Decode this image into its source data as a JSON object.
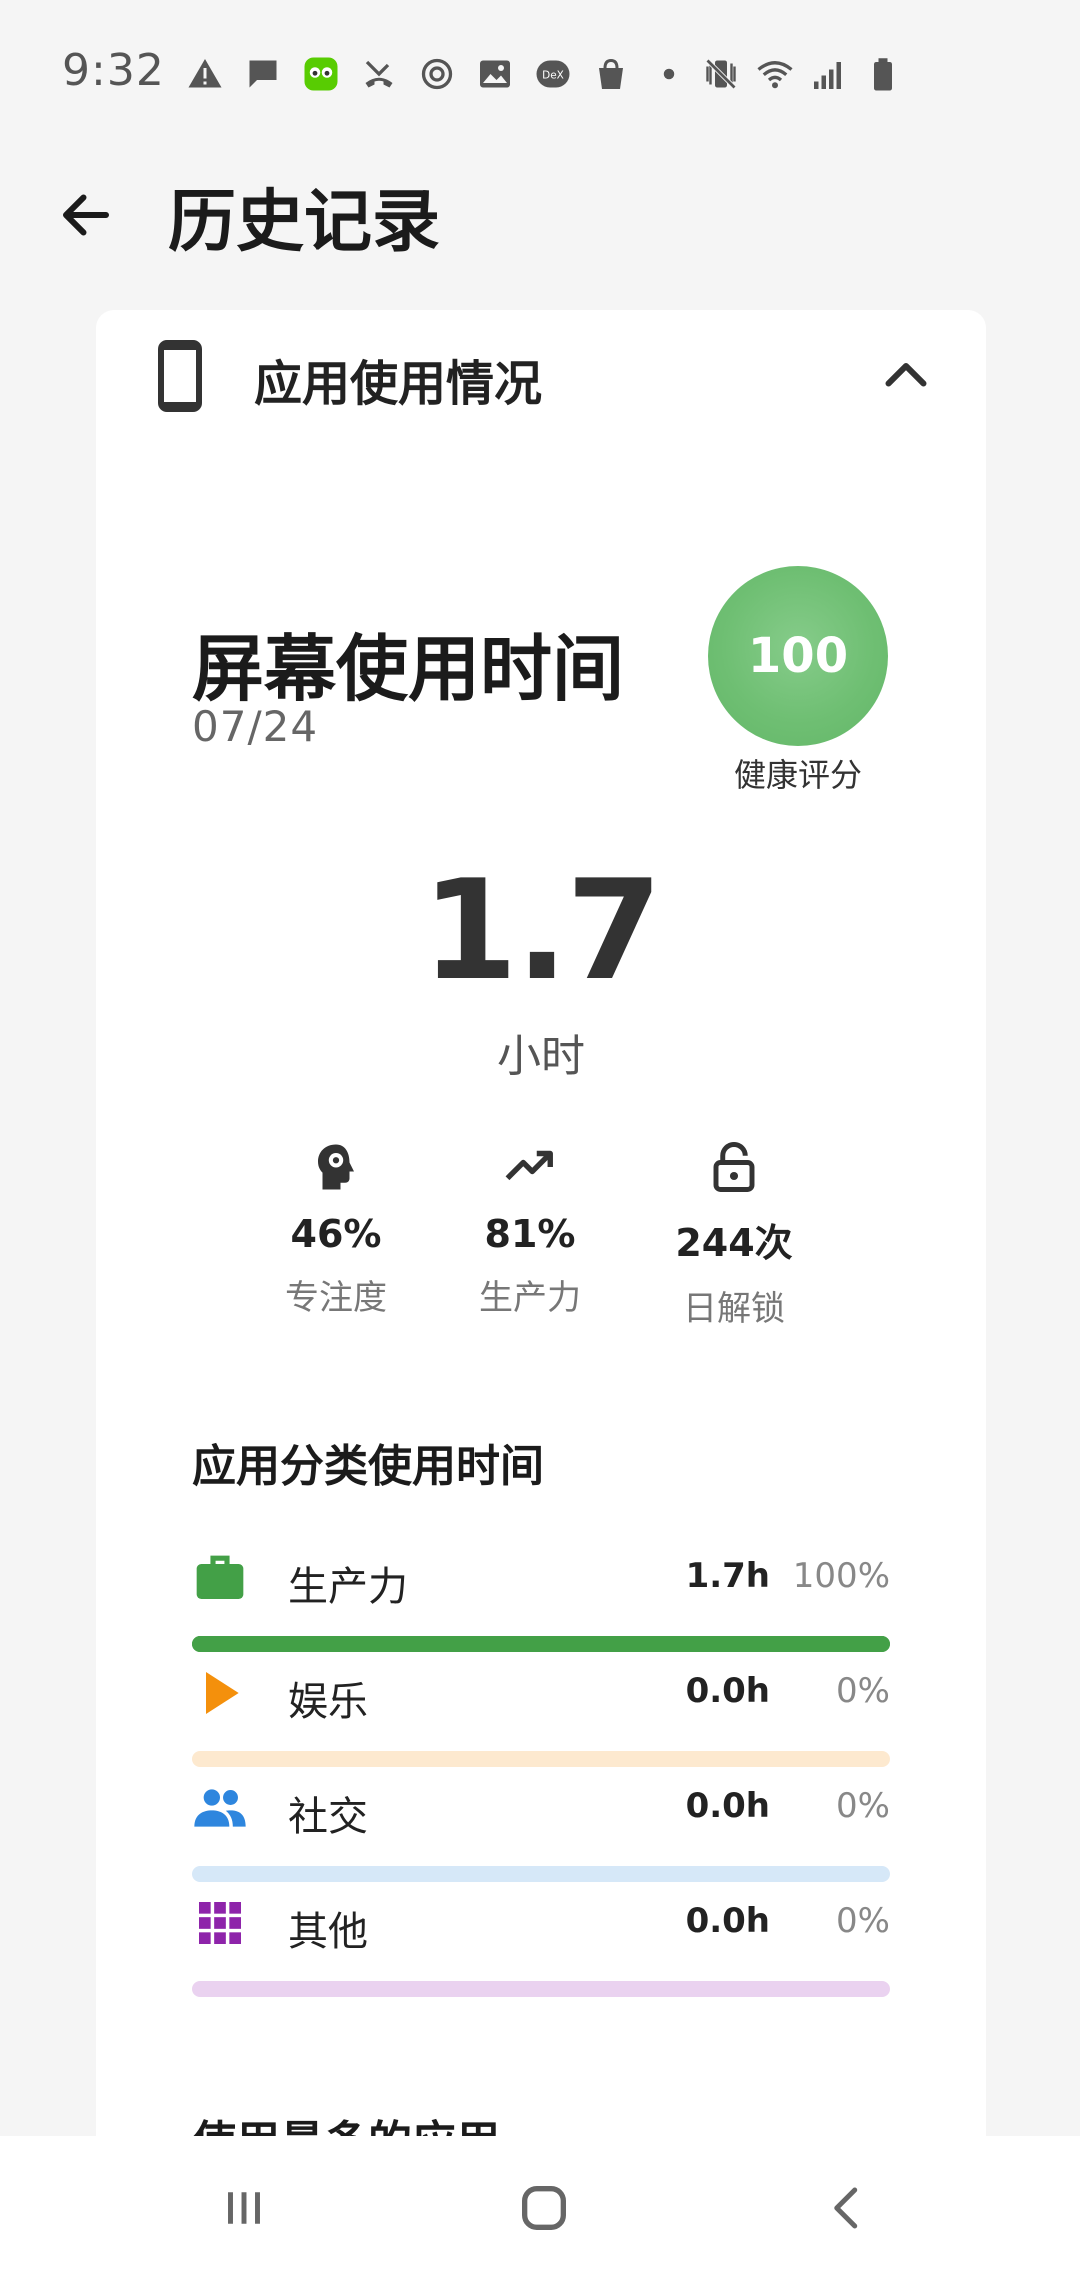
{
  "status_bar": {
    "time": "9:32",
    "icons": [
      "warning-icon",
      "message-icon",
      "duolingo-icon",
      "missed-call-icon",
      "sync-icon",
      "gallery-icon",
      "dex-icon",
      "shopping-bag-icon",
      "dot-icon"
    ],
    "right_icons": [
      "vibrate-mute-icon",
      "wifi-icon",
      "signal-icon",
      "battery-icon"
    ],
    "dex_label": "DeX"
  },
  "appbar": {
    "title": "历史记录"
  },
  "card": {
    "title": "应用使用情况",
    "screen_time_title": "屏幕使用时间",
    "date": "07/24",
    "health_score": "100",
    "health_label": "健康评分",
    "total_value": "1.7",
    "total_unit": "小时",
    "stats": [
      {
        "icon": "brain-gear-icon",
        "value": "46%",
        "label": "专注度"
      },
      {
        "icon": "trending-up-icon",
        "value": "81%",
        "label": "生产力"
      },
      {
        "icon": "unlock-icon",
        "value": "244次",
        "label": "日解锁"
      }
    ],
    "category_title": "应用分类使用时间",
    "categories": [
      {
        "name": "生产力",
        "hours": "1.7h",
        "percent": "100%",
        "fraction": 1.0,
        "color": "#43a047",
        "track": "#43a047",
        "icon": "briefcase-icon"
      },
      {
        "name": "娱乐",
        "hours": "0.0h",
        "percent": "0%",
        "fraction": 0.0,
        "color": "#f4900c",
        "track": "#fde9cf",
        "icon": "play-icon"
      },
      {
        "name": "社交",
        "hours": "0.0h",
        "percent": "0%",
        "fraction": 0.0,
        "color": "#2e86de",
        "track": "#d6e8f8",
        "icon": "people-icon"
      },
      {
        "name": "其他",
        "hours": "0.0h",
        "percent": "0%",
        "fraction": 0.0,
        "color": "#8e24aa",
        "track": "#ead2f0",
        "icon": "grid-icon"
      }
    ],
    "most_used_title": "使用最多的应用"
  },
  "navbar": {
    "items": [
      "recents-button",
      "home-button",
      "back-button"
    ]
  }
}
